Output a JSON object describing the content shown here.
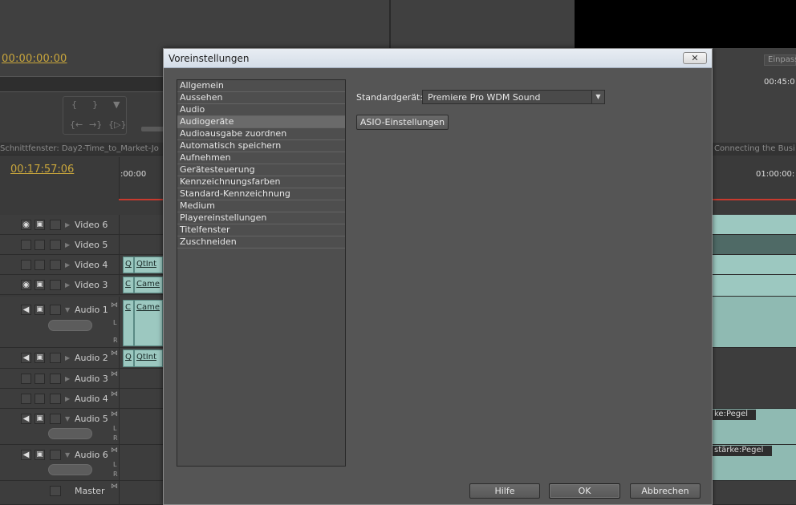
{
  "background": {
    "program_timecode": "00:00:00:00",
    "einpass_label": "Einpass",
    "program_time_right": "00:45:0",
    "sequence_tab_left": "Schnittfenster: Day2-Time_to_Market-Jo",
    "sequence_tab_right": "Connecting the Busi",
    "sequence_timecode": "00:17:57:06",
    "ruler_start": ":00:00",
    "ruler_right": "01:00:00:",
    "tracks": [
      {
        "label": "Video 6",
        "clips": []
      },
      {
        "label": "Video 5",
        "clips": []
      },
      {
        "label": "Video 4",
        "clips": [
          "Q",
          "QtInt"
        ]
      },
      {
        "label": "Video 3",
        "clips": [
          "C",
          "Came"
        ]
      },
      {
        "label": "Audio 1",
        "clips": [
          "C",
          "Came"
        ]
      },
      {
        "label": "Audio 2",
        "clips": [
          "Q",
          "QtInt"
        ]
      },
      {
        "label": "Audio 3",
        "clips": []
      },
      {
        "label": "Audio 4",
        "clips": []
      },
      {
        "label": "Audio 5",
        "clips": []
      },
      {
        "label": "Audio 6",
        "clips": []
      },
      {
        "label": "Master",
        "clips": []
      }
    ],
    "channel_l": "L",
    "channel_r": "R",
    "pegel_1": "ke:Pegel",
    "pegel_2": "stärke:Pegel"
  },
  "dialog": {
    "title": "Voreinstellungen",
    "close_glyph": "✕",
    "categories": [
      "Allgemein",
      "Aussehen",
      "Audio",
      "Audiogeräte",
      "Audioausgabe zuordnen",
      "Automatisch speichern",
      "Aufnehmen",
      "Gerätesteuerung",
      "Kennzeichnungsfarben",
      "Standard-Kennzeichnung",
      "Medium",
      "Playereinstellungen",
      "Titelfenster",
      "Zuschneiden"
    ],
    "selected_category": "Audiogeräte",
    "standard_device_label": "Standardgerät:",
    "standard_device_value": "Premiere Pro WDM Sound",
    "asio_button": "ASIO-Einstellungen",
    "help_button": "Hilfe",
    "ok_button": "OK",
    "cancel_button": "Abbrechen"
  }
}
